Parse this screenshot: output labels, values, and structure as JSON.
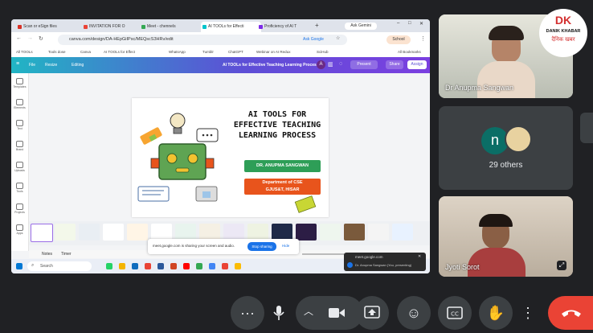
{
  "browser": {
    "tabs": [
      {
        "label": "Scan or eSign files"
      },
      {
        "label": "INVITATION FOR O"
      },
      {
        "label": "Meet - chennels"
      },
      {
        "label": "AI TOOLs for Effecti"
      },
      {
        "label": "Proficiency of AI T"
      }
    ],
    "ask_gemini": "Ask Gemini",
    "url": "canva.com/design/DA-HEpGiIPsc/MEQscS3HRv/edit",
    "ask_google": "Ask Google",
    "profile": "School",
    "bookmarks": [
      "All TOOLs",
      "Tools dose",
      "Canva",
      "AI TOOLs for Effect",
      "WhatsApp",
      "Tumblr",
      "ChatGPT",
      "Webinar on AI Redux",
      "SciHub"
    ],
    "all_bookmarks": "All Bookmarks"
  },
  "canva": {
    "file": "File",
    "resize": "Resize",
    "editing": "Editing",
    "doc_title": "AI TOOLs for Effective Teaching Learning Process",
    "avatar_letter": "A",
    "present": "Present",
    "share": "Share",
    "assign": "Assign",
    "rail": [
      "Templates",
      "Elements",
      "Text",
      "Brand",
      "Uploads",
      "Tools",
      "Projects",
      "Apps"
    ]
  },
  "slide": {
    "title_lines": [
      "AI TOOLS FOR",
      "EFFECTIVE TEACHING",
      "LEARNING PROCESS"
    ],
    "author": "DR. ANUPMA SANGWAN",
    "dept_line1": "Department of CSE",
    "dept_line2": "GJUS&T, HISAR"
  },
  "share_notice": {
    "text": "meet.google.com is sharing your screen and audio.",
    "stop": "Stop sharing",
    "hide": "Hide"
  },
  "notes_bar": {
    "notes": "Notes",
    "timer": "Timer"
  },
  "taskbar": {
    "search": "Search"
  },
  "popup": {
    "title": "meet.google.com",
    "subtitle": "Dr. Anupma Sangwan (You, presenting)"
  },
  "participants": {
    "presenter_name": "Dr Anupma Sangwan",
    "others_initial": "n",
    "others_count": "29 others",
    "bottom_name": "Jyoti Sorot"
  },
  "logo": {
    "line1": "DK",
    "line2": "DANIK KHABAR",
    "line3": "दैनिक खबर"
  },
  "colors": {
    "end_call": "#ea4335",
    "green_pill": "#2e9e57",
    "orange_pill": "#e8541c",
    "brand_gradient_start": "#21b5c4",
    "brand_gradient_end": "#7b3fe0"
  }
}
